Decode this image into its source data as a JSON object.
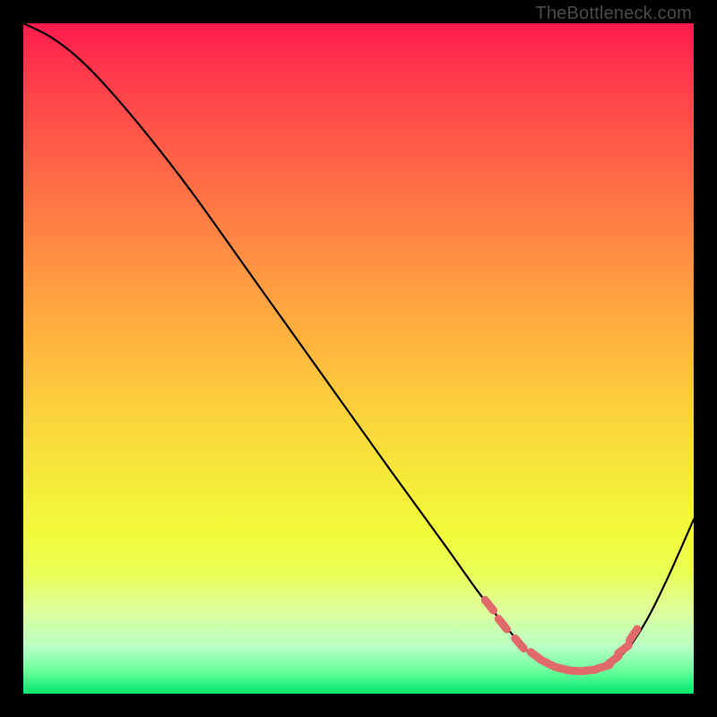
{
  "watermark": "TheBottleneck.com",
  "chart_data": {
    "type": "line",
    "title": "",
    "xlabel": "",
    "ylabel": "",
    "xlim": [
      0,
      100
    ],
    "ylim": [
      0,
      100
    ],
    "series": [
      {
        "name": "bottleneck-curve",
        "x": [
          0,
          4,
          8,
          12,
          18,
          25,
          35,
          45,
          55,
          63,
          68,
          72,
          75,
          77,
          79,
          81,
          83,
          85,
          87,
          90,
          93,
          96,
          100
        ],
        "values": [
          100,
          98,
          95,
          91,
          84,
          75,
          61,
          47,
          33,
          22,
          15,
          10,
          6.5,
          5,
          4,
          3.5,
          3.4,
          3.6,
          4.2,
          6.5,
          11,
          17,
          26
        ]
      }
    ],
    "markers": {
      "name": "highlight-points",
      "x": [
        69.5,
        71.5,
        74,
        76.5,
        78.5,
        80.5,
        82.5,
        84.5,
        86.5,
        88,
        89.5,
        91
      ],
      "values": [
        13.2,
        10.4,
        7.5,
        5.6,
        4.4,
        3.7,
        3.4,
        3.5,
        4.0,
        5.0,
        6.6,
        8.8
      ]
    },
    "gradient_stops": [
      {
        "pos": 0,
        "color": "#ff1a4d"
      },
      {
        "pos": 0.5,
        "color": "#ffb63e"
      },
      {
        "pos": 0.8,
        "color": "#f2fb3a"
      },
      {
        "pos": 1.0,
        "color": "#00e86b"
      }
    ]
  }
}
